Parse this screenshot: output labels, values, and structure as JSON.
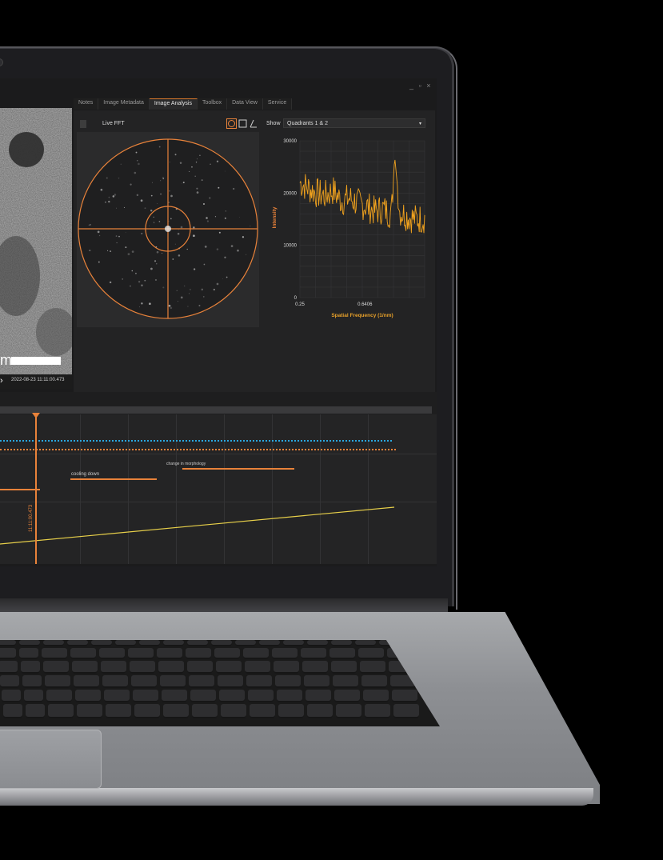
{
  "tabs": [
    {
      "label": "Notes"
    },
    {
      "label": "Image Metadata"
    },
    {
      "label": "Image Analysis"
    },
    {
      "label": "Toolbox"
    },
    {
      "label": "Data View"
    },
    {
      "label": "Service"
    }
  ],
  "active_tab": "Image Analysis",
  "fft": {
    "label": "Live FFT"
  },
  "show": {
    "label": "Show",
    "value": "Quadrants 1 & 2"
  },
  "chart_data": {
    "type": "line",
    "title": "",
    "xlabel": "Spatial Frequency (1/nm)",
    "ylabel": "Intensity",
    "x_tick_labels": [
      "0.25",
      "0.6406"
    ],
    "y_tick_labels": [
      "0",
      "10000",
      "20000",
      "30000"
    ],
    "ylim": [
      0,
      30000
    ],
    "xlim": [
      0.25,
      1.0
    ],
    "grid": true,
    "series": [
      {
        "color": "#f0a21e",
        "x": [
          0.25,
          0.3,
          0.35,
          0.4,
          0.45,
          0.5,
          0.55,
          0.6,
          0.65,
          0.7,
          0.75,
          0.8,
          0.82,
          0.85,
          0.9,
          0.95,
          1.0
        ],
        "values": [
          22000,
          21000,
          20000,
          19500,
          20500,
          18500,
          19000,
          18000,
          17500,
          16500,
          17000,
          16000,
          27000,
          16500,
          15500,
          15000,
          15200
        ]
      }
    ]
  },
  "image": {
    "timestamp": "2022-08-23 11:11:00.473",
    "nav_icon": "chevron-right-icon",
    "scale_suffix": "m"
  },
  "timeline": {
    "events": [
      {
        "label": "cooling down"
      },
      {
        "label": "change in morphology"
      }
    ],
    "cursor_label": "11:11:00.473"
  },
  "colors": {
    "accent": "#e8823a",
    "series_blue": "#2aa8e0",
    "trend_yellow": "#e8d04a"
  },
  "window_controls": [
    "_",
    "▫",
    "×"
  ]
}
